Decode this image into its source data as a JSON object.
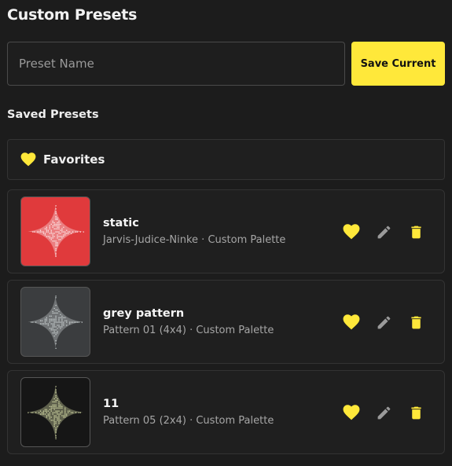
{
  "header": {
    "title": "Custom Presets"
  },
  "form": {
    "placeholder": "Preset Name",
    "value": "",
    "save_label": "Save Current"
  },
  "saved": {
    "label": "Saved Presets"
  },
  "favorites": {
    "label": "Favorites"
  },
  "colors": {
    "accent": "#ffe83a",
    "background": "#1c1c1c",
    "card": "#1f1f1f",
    "edit_icon": "#9a9a9a"
  },
  "presets": [
    {
      "name": "static",
      "subtitle": "Jarvis-Judice-Ninke · Custom Palette",
      "thumb_bg": "#e03a3c",
      "star_color": "#ffffff",
      "favorite": true
    },
    {
      "name": "grey pattern",
      "subtitle": "Pattern 01 (4x4) · Custom Palette",
      "thumb_bg": "#3b3d3f",
      "star_color": "#d6dede",
      "favorite": true
    },
    {
      "name": "11",
      "subtitle": "Pattern 05 (2x4) · Custom Palette",
      "thumb_bg": "#161616",
      "star_color": "#e8efb5",
      "favorite": true
    }
  ]
}
